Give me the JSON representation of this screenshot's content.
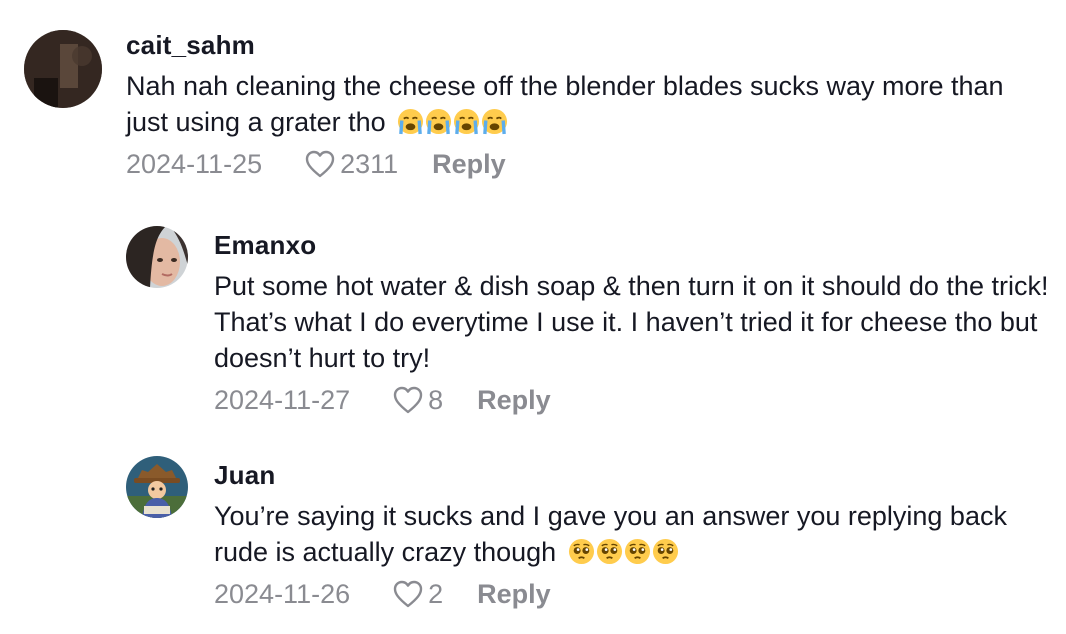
{
  "comments": [
    {
      "username": "cait_sahm",
      "text": "Nah nah cleaning the cheese off the blender blades sucks way more than just using a grater tho",
      "emoji": [
        "crying-face",
        "crying-face",
        "crying-face",
        "crying-face"
      ],
      "date": "2024-11-25",
      "likes": "2311",
      "reply_label": "Reply"
    },
    {
      "username": "Emanxo",
      "text": "Put some hot water & dish soap & then turn it on it should do the trick! That’s what I do everytime I use it. I haven’t tried it for cheese tho but doesn’t hurt to try!",
      "date": "2024-11-27",
      "likes": "8",
      "reply_label": "Reply"
    },
    {
      "username": "Juan",
      "text": "You’re saying it sucks and I gave you an answer you replying back rude is actually crazy though",
      "emoji": [
        "pleading-face",
        "pleading-face",
        "pleading-face",
        "pleading-face"
      ],
      "date": "2024-11-26",
      "likes": "2",
      "reply_label": "Reply"
    }
  ],
  "colors": {
    "text": "#161823",
    "muted": "#8a8b91",
    "emoji_yellow": "#ffcc4d",
    "emoji_tear": "#5dadec"
  }
}
